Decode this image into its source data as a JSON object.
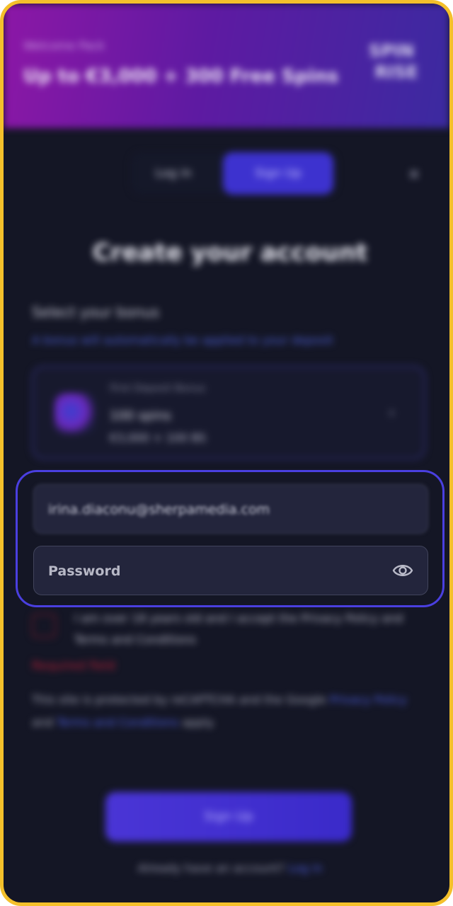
{
  "banner": {
    "welcome": "Welcome Pack",
    "offer": "Up to €3,000 + 300 Free Spins",
    "logo_line1": "SPIN",
    "logo_line2": "RISE"
  },
  "tabs": {
    "login": "Log in",
    "signup": "Sign Up"
  },
  "close_glyph": "×",
  "title": "Create your account",
  "bonus": {
    "heading": "Select your bonus",
    "subheading": "A bonus will automatically be applied to your deposit",
    "label": "First Deposit Bonus",
    "value": "100 spins",
    "code": "€3,000 + 100 BS",
    "chevron": "›"
  },
  "form": {
    "email_value": "irina.diaconu@sherpamedia.com",
    "password_placeholder": "Password",
    "eye_icon": "eye-icon"
  },
  "terms": {
    "text": "I am over 18 years old and I accept the Privacy Policy and Terms and Conditions"
  },
  "required": "Required field",
  "recaptcha": {
    "prefix": "This site is protected by reCAPTCHA and the Google",
    "link1": "Privacy Policy",
    "middle": "and",
    "link2": "Terms and Conditions",
    "suffix": "apply."
  },
  "signup_button": "Sign Up",
  "already": {
    "text": "Already have an account?",
    "link": "Log in"
  },
  "colors": {
    "frame_border": "#f4c02b",
    "focus_border": "#4a3fe0",
    "background": "#141625",
    "accent": "#3d32cf"
  }
}
